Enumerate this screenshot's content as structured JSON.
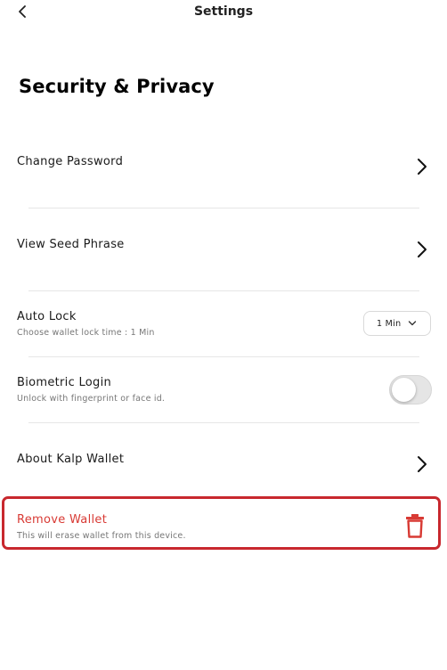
{
  "header": {
    "title": "Settings",
    "back_icon": "chevron-left-icon"
  },
  "page_title": "Security & Privacy",
  "items": {
    "change_password": {
      "label": "Change Password",
      "icon": "chevron-right-icon"
    },
    "view_seed": {
      "label": "View Seed Phrase",
      "icon": "chevron-right-icon"
    },
    "auto_lock": {
      "label": "Auto Lock",
      "subtitle": "Choose wallet lock time : 1 Min",
      "selected": "1 Min",
      "icon": "chevron-down-icon"
    },
    "biometric": {
      "label": "Biometric Login",
      "subtitle": "Unlock with fingerprint or face id.",
      "enabled": false
    },
    "about": {
      "label": "About Kalp Wallet",
      "icon": "chevron-right-icon"
    },
    "remove_wallet": {
      "label": "Remove Wallet",
      "subtitle": "This will erase wallet from this device.",
      "icon": "trash-icon"
    }
  },
  "colors": {
    "danger": "#d83a34",
    "highlight_border": "#c8282e",
    "divider": "#e6e6e6",
    "toggle_off": "#e5e5e5"
  }
}
